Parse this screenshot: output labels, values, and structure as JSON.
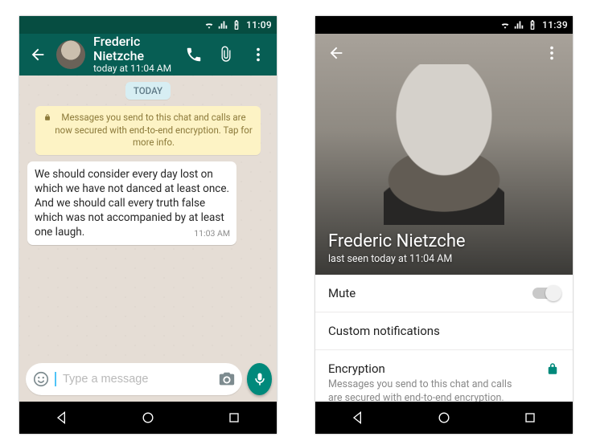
{
  "colors": {
    "primary": "#075e54",
    "accent": "#00897b"
  },
  "left": {
    "status": {
      "time": "11:09"
    },
    "header": {
      "contact_name": "Frederic Nietzche",
      "subtitle": "today at 11:04 AM"
    },
    "date_chip": "TODAY",
    "encryption_chip": "Messages you send to this chat and calls are now secured with end-to-end encryption. Tap for more info.",
    "messages": [
      {
        "text": "We should consider every day lost on which we have not danced at least once. And we should call every truth false which was not accompanied by at least one laugh.",
        "time": "11:03 AM"
      }
    ],
    "composer": {
      "placeholder": "Type a message"
    }
  },
  "right": {
    "status": {
      "time": "11:39"
    },
    "hero": {
      "name": "Frederic Nietzche",
      "subtitle": "last seen today at 11:04 AM"
    },
    "rows": {
      "mute": {
        "label": "Mute",
        "on": false
      },
      "custom": {
        "label": "Custom notifications"
      },
      "encryption": {
        "label": "Encryption",
        "sub": "Messages you send to this chat and calls are secured with end-to-end encryption. Tap to verify."
      }
    }
  }
}
